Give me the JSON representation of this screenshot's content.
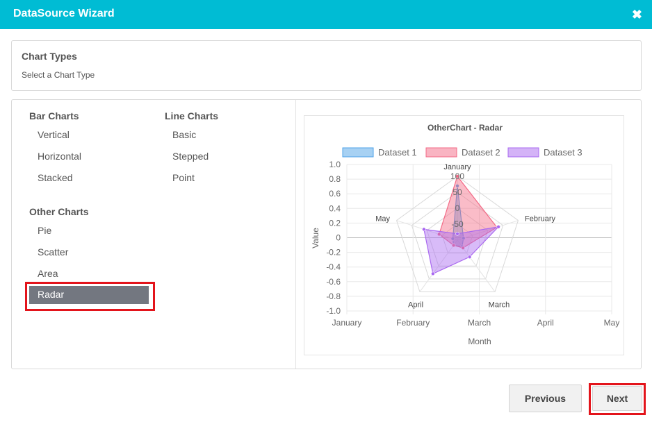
{
  "window": {
    "title": "DataSource Wizard",
    "close_glyph": "✖",
    "close_icon": "close-icon"
  },
  "header_panel": {
    "title": "Chart Types",
    "subtitle": "Select a Chart Type"
  },
  "groups": {
    "bar": {
      "title": "Bar Charts",
      "items": [
        "Vertical",
        "Horizontal",
        "Stacked"
      ]
    },
    "line": {
      "title": "Line Charts",
      "items": [
        "Basic",
        "Stepped",
        "Point"
      ]
    },
    "other": {
      "title": "Other Charts",
      "items": [
        "Pie",
        "Scatter",
        "Area",
        "Radar"
      ],
      "selected": "Radar"
    }
  },
  "colors": {
    "accent": "#00bcd4",
    "selected_bg": "#737780",
    "highlight": "#e3141b"
  },
  "buttons": {
    "previous": "Previous",
    "next": "Next"
  },
  "chart_data": {
    "type": "radar",
    "title": "OtherChart - Radar",
    "categories": [
      "January",
      "February",
      "March",
      "April",
      "May"
    ],
    "radial_ticks": [
      "100",
      "50",
      "0",
      "-50"
    ],
    "r_range": [
      -100,
      100
    ],
    "series": [
      {
        "name": "Dataset 1",
        "values": [
          70,
          -80,
          -75,
          -80,
          -85
        ],
        "color": "#4fa3e8"
      },
      {
        "name": "Dataset 2",
        "values": [
          100,
          30,
          -70,
          -80,
          -40
        ],
        "color": "#f36a86"
      },
      {
        "name": "Dataset 3",
        "values": [
          -80,
          35,
          -35,
          30,
          10
        ],
        "color": "#a968f0"
      }
    ],
    "xlabel": "Month",
    "ylabel": "Value",
    "x_ticks": [
      "January",
      "February",
      "March",
      "April",
      "May"
    ],
    "y_ticks": [
      "1.0",
      "0.8",
      "0.6",
      "0.4",
      "0.2",
      "0",
      "-0.2",
      "-0.4",
      "-0.6",
      "-0.8",
      "-1.0"
    ],
    "ylim": [
      -1.0,
      1.0
    ],
    "legend": "top"
  }
}
